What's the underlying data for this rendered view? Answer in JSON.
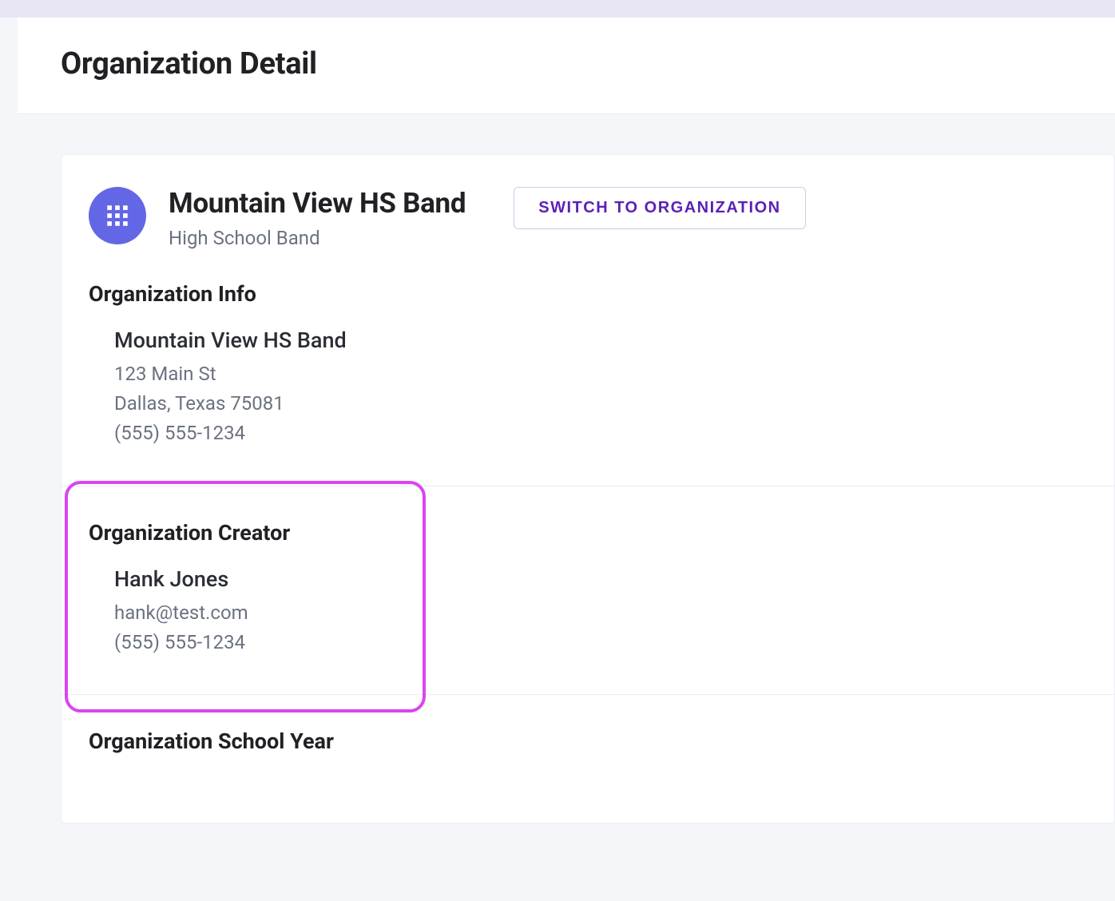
{
  "page": {
    "title": "Organization Detail"
  },
  "organization": {
    "name": "Mountain View HS Band",
    "type": "High School Band",
    "switch_button_label": "SWITCH TO ORGANIZATION"
  },
  "sections": {
    "info": {
      "title": "Organization Info",
      "name": "Mountain View HS Band",
      "address_line1": "123 Main St",
      "address_line2": "Dallas, Texas 75081",
      "phone": "(555) 555-1234"
    },
    "creator": {
      "title": "Organization Creator",
      "name": "Hank Jones",
      "email": "hank@test.com",
      "phone": "(555) 555-1234"
    },
    "school_year": {
      "title": "Organization School Year"
    }
  }
}
